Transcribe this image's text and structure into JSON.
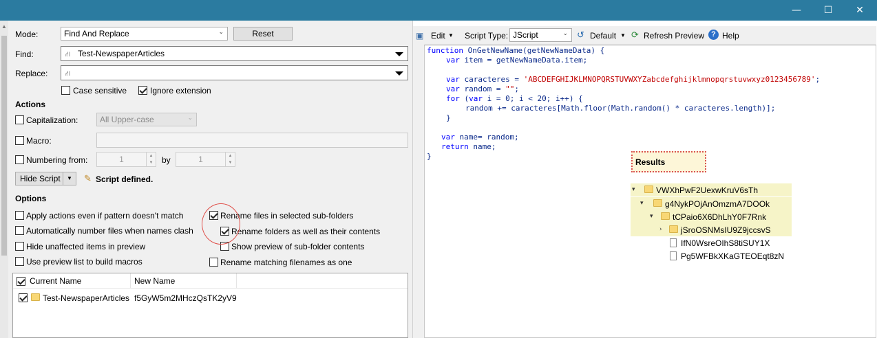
{
  "window": {
    "controls": [
      "—",
      "☐",
      "✕"
    ]
  },
  "left": {
    "mode_label": "Mode:",
    "mode_value": "Find And Replace",
    "reset_label": "Reset",
    "find_label": "Find:",
    "find_value": "Test-NewspaperArticles",
    "replace_label": "Replace:",
    "replace_value": "",
    "case_sensitive": "Case sensitive",
    "ignore_extension": "Ignore extension",
    "actions_heading": "Actions",
    "capitalization_label": "Capitalization:",
    "capitalization_value": "All Upper-case",
    "macro_label": "Macro:",
    "numbering_label": "Numbering from:",
    "numbering_from": "1",
    "by_label": "by",
    "numbering_by": "1",
    "hide_script": "Hide Script",
    "script_defined": "Script defined.",
    "options_heading": "Options",
    "options": [
      "Apply actions even if pattern doesn't match",
      "Automatically number files when names clash",
      "Hide unaffected items in preview",
      "Use preview list to build macros",
      "Rename files in selected sub-folders",
      "Rename folders as well as their contents",
      "Show preview of sub-folder contents",
      "Rename matching filenames as one"
    ],
    "list": {
      "col_current": "Current Name",
      "col_new": "New Name",
      "row_current": "Test-NewspaperArticles",
      "row_new": "f5GyW5m2MHczQsTK2yV9"
    }
  },
  "right": {
    "edit": "Edit",
    "script_type_label": "Script Type:",
    "script_type_value": "JScript",
    "default_label": "Default",
    "refresh_preview": "Refresh Preview",
    "help": "Help",
    "code": {
      "l1a": "function",
      "l1b": " OnGetNewName(getNewNameData) {",
      "l2a": "var",
      "l2b": " item = getNewNameData.item;",
      "l3a": "var",
      "l3b": " caracteres = ",
      "l3c": "'ABCDEFGHIJKLMNOPQRSTUVWXYZabcdefghijklmnopqrstuvwxyz0123456789'",
      "l3d": ";",
      "l4a": "var",
      "l4b": " random = ",
      "l4c": "\"\"",
      "l4d": ";",
      "l5a": "for",
      "l5b": " (",
      "l5c": "var",
      "l5d": " i = 0; i < 20; i++) {",
      "l6": "random += caracteres[Math.floor(Math.random() * caracteres.length)];",
      "l7": "}",
      "l8a": "var",
      "l8b": " name= random;",
      "l9a": "return",
      "l9b": " name;",
      "l10": "}"
    },
    "results_heading": "Results",
    "tree": [
      "VWXhPwF2UexwKruV6sTh",
      "g4NykPOjAnOmzmA7DOOk",
      "tCPaio6X6DhLhY0F7Rnk",
      "jSroOSNMsIU9Z9jccsvS",
      "IfN0WsreOIhS8tiSUY1X",
      "Pg5WFBkXKaGTEOEqt8zN"
    ]
  }
}
